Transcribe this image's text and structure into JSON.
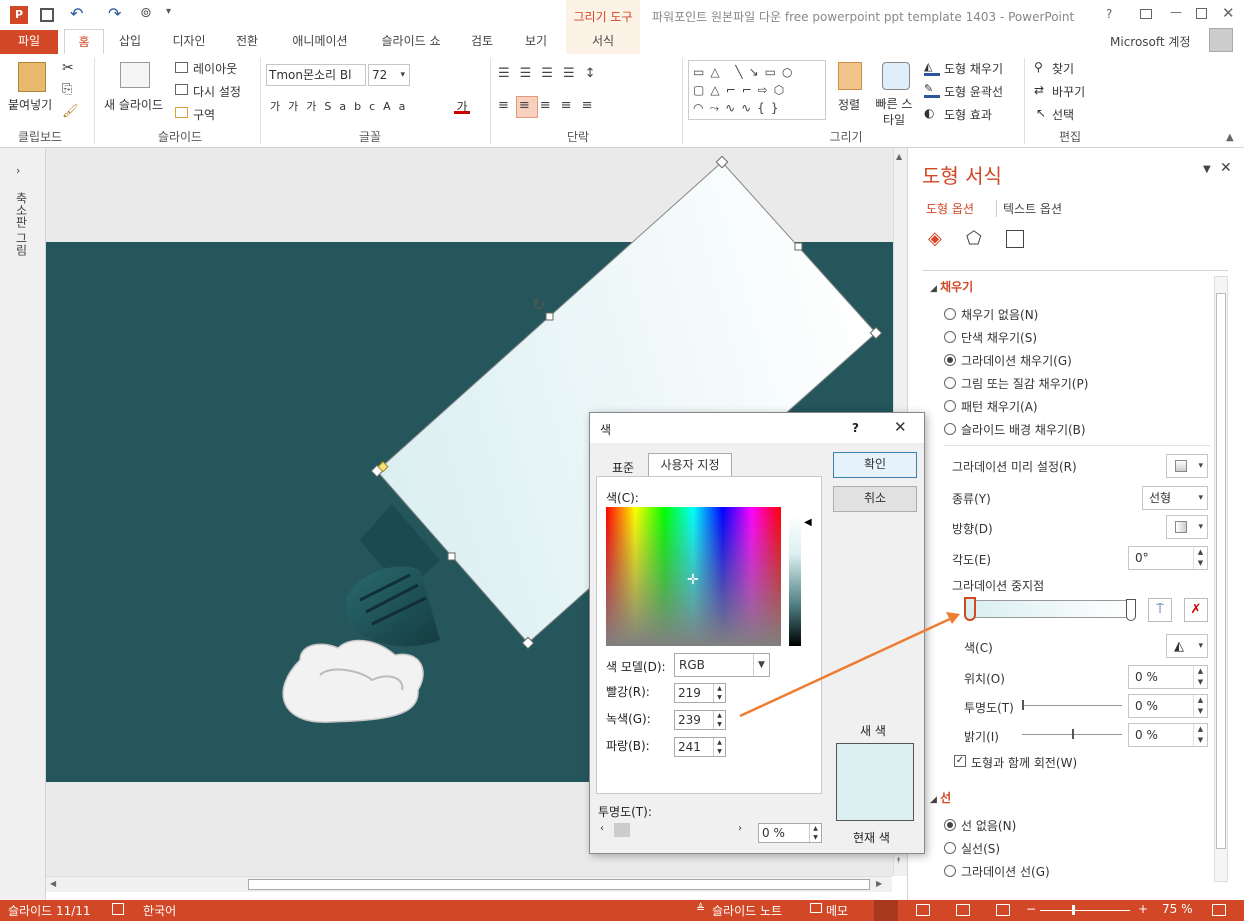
{
  "titlebar": {
    "title": "파워포인트 원본파일 다운 free powerpoint ppt template 1403 - PowerPoint",
    "context_group": "그리기 도구",
    "help": "?"
  },
  "tabs": {
    "file": "파일",
    "home": "홈",
    "insert": "삽입",
    "design": "디자인",
    "transitions": "전환",
    "animations": "애니메이션",
    "slideshow": "슬라이드 쇼",
    "review": "검토",
    "view": "보기",
    "format": "서식"
  },
  "account": "Microsoft 계정",
  "ribbon": {
    "clipboard": {
      "paste": "붙여넣기",
      "group": "클립보드"
    },
    "slides": {
      "new_slide": "새 슬라이드",
      "layout": "레이아웃",
      "reset": "다시 설정",
      "section": "구역",
      "group": "슬라이드"
    },
    "font": {
      "name": "Tmon몬소리 Bl",
      "size": "72",
      "group": "글꼴"
    },
    "paragraph": {
      "group": "단락"
    },
    "drawing": {
      "arrange": "정렬",
      "quick_styles": "빠른 스타일",
      "fill": "도형 채우기",
      "outline": "도형 윤곽선",
      "effects": "도형 효과",
      "group": "그리기"
    },
    "editing": {
      "find": "찾기",
      "replace": "바꾸기",
      "select": "선택",
      "group": "편집"
    }
  },
  "left_strip": {
    "label": "축소판 그림"
  },
  "pane": {
    "title": "도형 서식",
    "tab_shape": "도형 옵션",
    "tab_text": "텍스트 옵션",
    "fill_header": "채우기",
    "fill_options": [
      "채우기 없음(N)",
      "단색 채우기(S)",
      "그라데이션 채우기(G)",
      "그림 또는 질감 채우기(P)",
      "패턴 채우기(A)",
      "슬라이드 배경 채우기(B)"
    ],
    "selected_fill": 2,
    "preset_label": "그라데이션 미리 설정(R)",
    "type_label": "종류(Y)",
    "type_value": "선형",
    "direction_label": "방향(D)",
    "angle_label": "각도(E)",
    "angle_value": "0°",
    "stops_label": "그라데이션 중지점",
    "color_label": "색(C)",
    "position_label": "위치(O)",
    "position_value": "0 %",
    "transparency_label": "투명도(T)",
    "transparency_value": "0 %",
    "brightness_label": "밝기(I)",
    "brightness_value": "0 %",
    "rotate_label": "도형과 함께 회전(W)",
    "line_header": "선",
    "line_options": [
      "선 없음(N)",
      "실선(S)",
      "그라데이션 선(G)"
    ],
    "selected_line": 0
  },
  "dialog": {
    "title": "색",
    "help": "?",
    "tab_standard": "표준",
    "tab_custom": "사용자 지정",
    "colors_label": "색(C):",
    "model_label": "색 모델(D):",
    "model_value": "RGB",
    "red_label": "빨강(R):",
    "red": "219",
    "green_label": "녹색(G):",
    "green": "239",
    "blue_label": "파랑(B):",
    "blue": "241",
    "transparency_label": "투명도(T):",
    "transparency": "0 %",
    "ok": "확인",
    "cancel": "취소",
    "new_label": "새 색",
    "current_label": "현재 색",
    "new_color": "#dbeff1"
  },
  "status": {
    "slide": "슬라이드 11/11",
    "language": "한국어",
    "notes": "슬라이드 노트",
    "comments": "메모",
    "zoom": "75 %"
  },
  "colors": {
    "accent": "#d24726",
    "slide_bg": "#24565c",
    "arrow": "#ed7d31"
  }
}
